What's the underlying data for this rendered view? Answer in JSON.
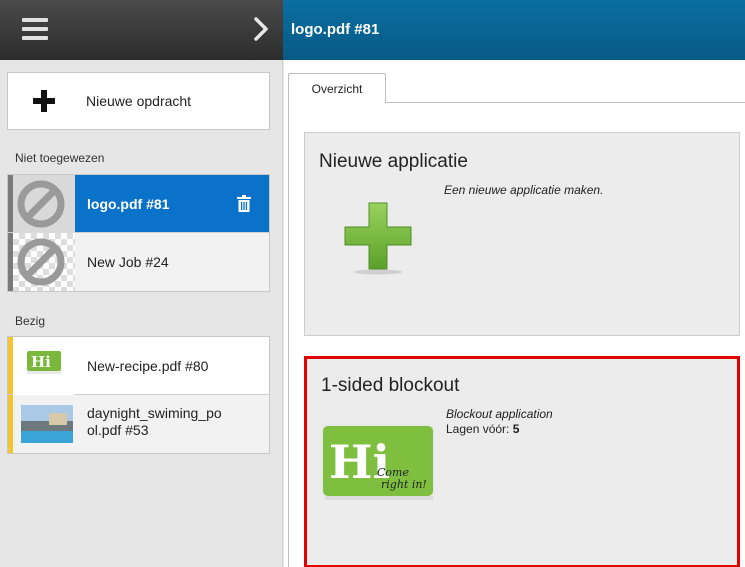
{
  "header": {
    "job_title": "logo.pdf #81",
    "menu_icon": "hamburger-menu-icon",
    "collapse_icon": "chevron-right-icon"
  },
  "sidebar": {
    "new_job_label": "Nieuwe opdracht",
    "sections": [
      {
        "label": "Niet toegewezen",
        "items": [
          {
            "name": "logo.pdf #81",
            "selected": true,
            "thumb": "no-preview-icon",
            "stripe_color": "#7a7a7a"
          },
          {
            "name": "New Job #24",
            "selected": false,
            "thumb": "no-preview-icon",
            "stripe_color": "#7a7a7a"
          }
        ]
      },
      {
        "label": "Bezig",
        "items": [
          {
            "name": "New-recipe.pdf #80",
            "selected": false,
            "thumb": "hi-logo-thumbnail",
            "stripe_color": "#f5c531"
          },
          {
            "name_line1": "daynight_swiming_po",
            "name_line2": "ol.pdf #53",
            "selected": false,
            "thumb": "pool-photo-thumbnail",
            "stripe_color": "#f5c531"
          }
        ]
      }
    ]
  },
  "main": {
    "tab_label": "Overzicht",
    "cards": [
      {
        "title": "Nieuwe applicatie",
        "description": "Een nieuwe applicatie maken.",
        "icon": "green-plus-icon"
      },
      {
        "title": "1-sided blockout",
        "description": "Blockout application",
        "layers_label": "Lagen vóór: ",
        "layers_value": "5",
        "icon": "hi-logo-image",
        "logo_text": "Hi",
        "logo_script_line1": "Come",
        "logo_script_line2": "right in!"
      }
    ]
  },
  "colors": {
    "header_dark": "#3a3a3a",
    "header_blue": "#0b6ea1",
    "selected_blue": "#0a72c9",
    "busy_stripe": "#f5c531",
    "highlight_border": "#e00000",
    "plus_green": "#79c043"
  }
}
